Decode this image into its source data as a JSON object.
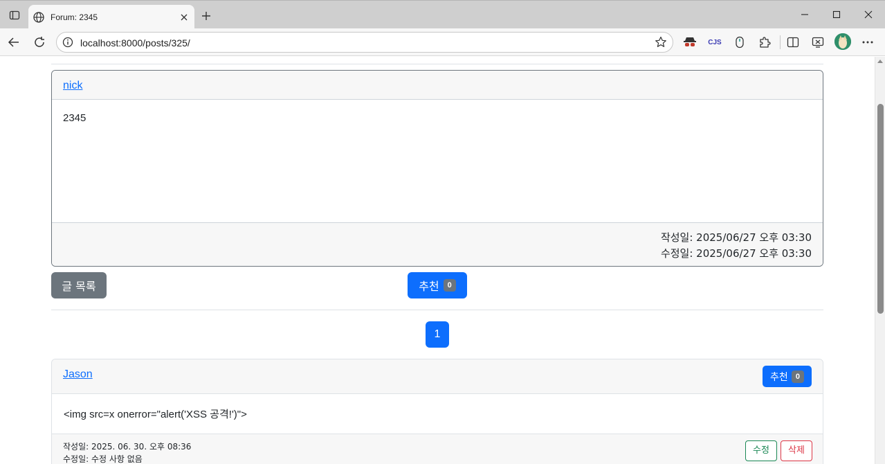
{
  "browser": {
    "tab_title": "Forum: 2345",
    "url": "localhost:8000/posts/325/",
    "icons": {
      "tab_actions": "tab-actions-icon",
      "favicon": "globe-icon",
      "tab_close": "close-icon",
      "new_tab": "plus-icon",
      "minimize": "minimize-icon",
      "maximize": "maximize-icon",
      "close_window": "close-icon",
      "back": "back-arrow-icon",
      "refresh": "refresh-icon",
      "site_info": "info-icon",
      "favorite": "star-icon",
      "extensions": [
        "incognito-extension-icon",
        "cjs-extension-icon",
        "mouse-extension-icon",
        "puzzle-icon"
      ],
      "split_screen": "split-screen-icon",
      "screenshot": "screenshot-icon",
      "more": "more-icon"
    },
    "ext_cjs_label": "CJS"
  },
  "post": {
    "author": "nick",
    "content": "2345",
    "created": "작성일: 2025/06/27 오후 03:30",
    "modified": "수정일: 2025/06/27 오후 03:30",
    "list_button": "글 목록",
    "recommend_label": "추천",
    "recommend_count": "0"
  },
  "pagination": {
    "current_page": "1"
  },
  "comments": [
    {
      "author": "Jason",
      "recommend_label": "추천",
      "recommend_count": "0",
      "content": "<img src=x onerror=\"alert('XSS 공격!')\">",
      "created": "작성일: 2025. 06. 30. 오후 08:36",
      "modified": "수정일: 수정 사항 없음",
      "edit_label": "수정",
      "delete_label": "삭제"
    }
  ],
  "colors": {
    "primary": "#0d6efd",
    "secondary": "#6c757d",
    "success": "#198754",
    "danger": "#dc3545"
  }
}
